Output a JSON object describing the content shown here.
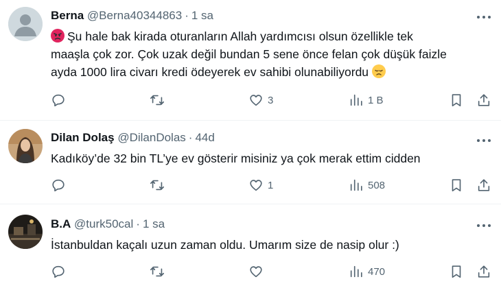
{
  "tweets": [
    {
      "name": "Berna",
      "handle": "@Berna40344863",
      "separator": "·",
      "time": "1 sa",
      "lines": [
        "Şu hale bak kirada oturanların Allah yardımcısı olsun özellikle tek",
        "maaşla çok zor. Çok uzak değil bundan 5 sene önce felan çok düşük faizle",
        "ayda 1000 lira civarı kredi ödeyerek ev sahibi olunabiliyordu"
      ],
      "emojis": [
        "angry-face",
        "disappointed-face"
      ],
      "replies": "",
      "retweets": "",
      "likes": "3",
      "views": "1 B"
    },
    {
      "name": "Dilan Dolaş",
      "handle": "@DilanDolas",
      "separator": "·",
      "time": "44d",
      "lines": [
        "Kadıköy’de 32 bin TL’ye ev gösterir misiniz ya çok merak ettim cidden"
      ],
      "replies": "",
      "retweets": "",
      "likes": "1",
      "views": "508"
    },
    {
      "name": "B.A",
      "handle": "@turk50cal",
      "separator": "·",
      "time": "1 sa",
      "lines": [
        "İstanbuldan kaçalı uzun zaman oldu. Umarım size de nasip olur :)"
      ],
      "replies": "",
      "retweets": "",
      "likes": "",
      "views": "470"
    }
  ],
  "colors": {
    "text": "#0f1419",
    "secondary": "#536471",
    "divider": "#eff3f4",
    "default_avatar": "#cfd9de"
  },
  "icons": [
    "reply-icon",
    "retweet-icon",
    "like-icon",
    "views-icon",
    "bookmark-icon",
    "share-icon",
    "more-icon"
  ]
}
